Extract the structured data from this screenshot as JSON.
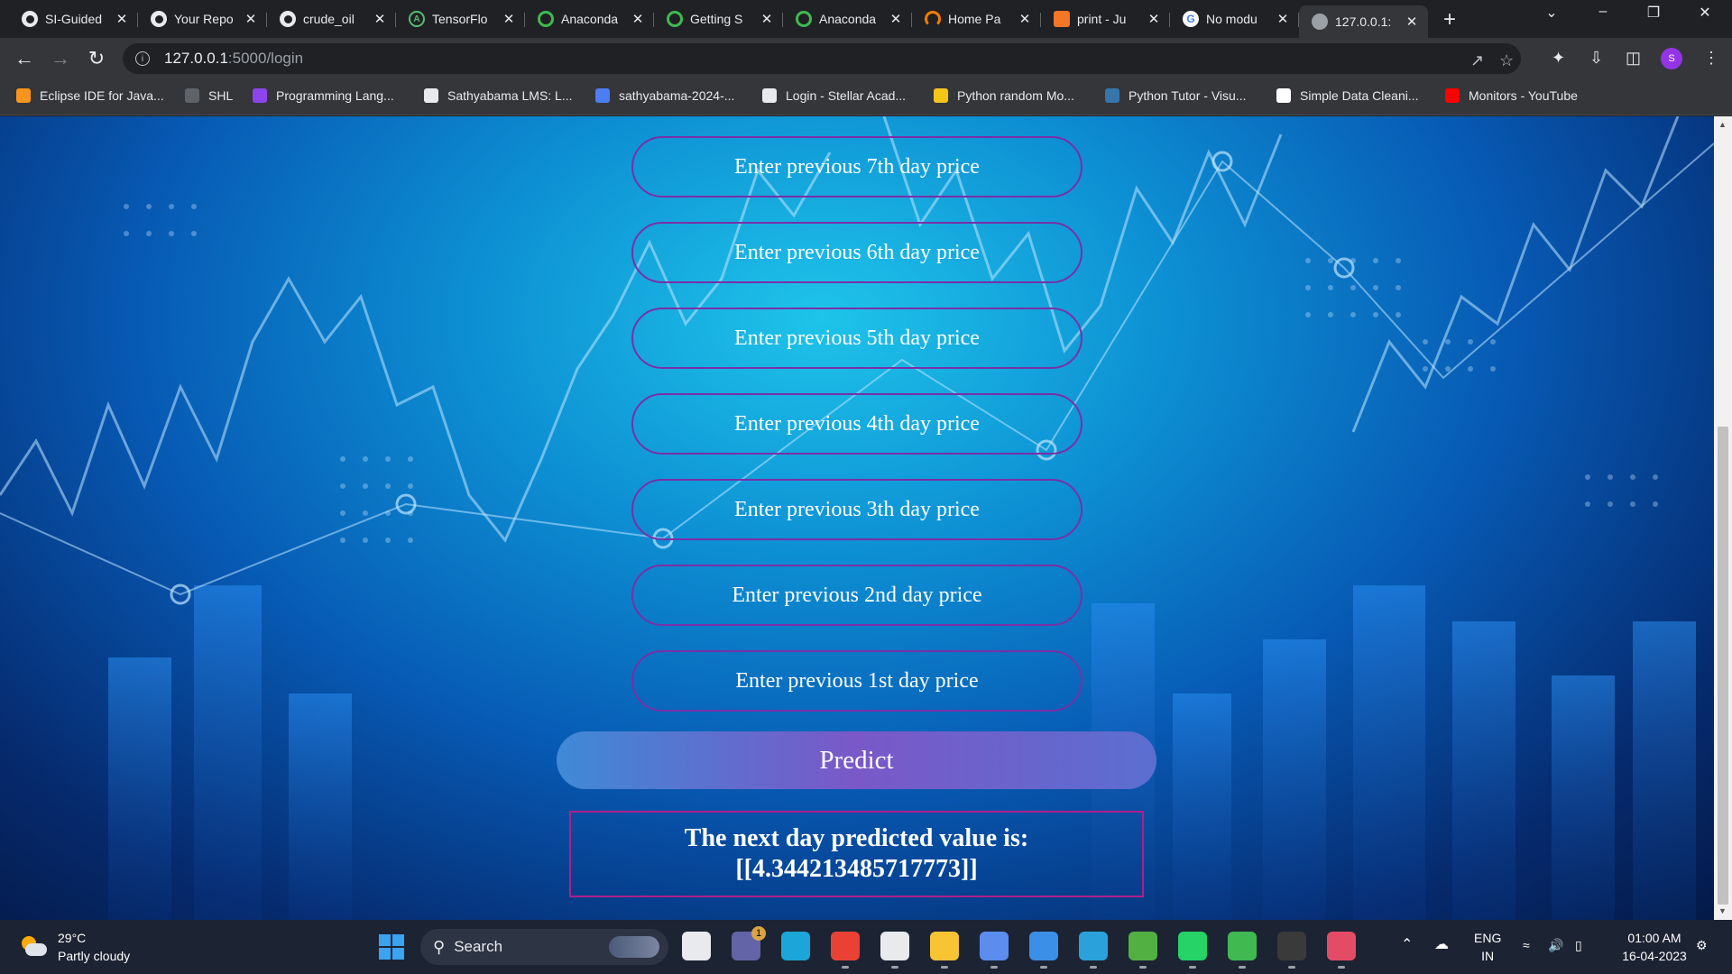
{
  "browser": {
    "tabs": [
      {
        "title": "SI-Guided",
        "favicon": "github-icon",
        "active": false
      },
      {
        "title": "Your Repo",
        "favicon": "github-icon",
        "active": false
      },
      {
        "title": "crude_oil",
        "favicon": "github-icon",
        "active": false
      },
      {
        "title": "TensorFlo",
        "favicon": "tensorflow-icon",
        "active": false
      },
      {
        "title": "Anaconda",
        "favicon": "anaconda-icon",
        "active": false
      },
      {
        "title": "Getting S",
        "favicon": "anaconda-icon",
        "active": false
      },
      {
        "title": "Anaconda",
        "favicon": "anaconda-icon",
        "active": false
      },
      {
        "title": "Home Pa",
        "favicon": "jupyter-home-icon",
        "active": false
      },
      {
        "title": "print - Ju",
        "favicon": "jupyter-notebook-icon",
        "active": false
      },
      {
        "title": "No modu",
        "favicon": "google-icon",
        "active": false
      },
      {
        "title": "127.0.0.1:",
        "favicon": "globe-icon",
        "active": true
      }
    ],
    "new_tab_glyph": "+",
    "address": {
      "host": "127.0.0.1",
      "path": ":5000/login"
    },
    "profile_initial": "S",
    "bookmarks": [
      {
        "label": "Eclipse IDE for Java...",
        "color": "#f7941e"
      },
      {
        "label": "SHL",
        "color": "#5f6368"
      },
      {
        "label": "Programming Lang...",
        "color": "#8e44ec"
      },
      {
        "label": "Sathyabama LMS: L...",
        "color": "#e8eaed"
      },
      {
        "label": "sathyabama-2024-...",
        "color": "#4c7ef3"
      },
      {
        "label": "Login - Stellar Acad...",
        "color": "#e8eaed"
      },
      {
        "label": "Python random Mo...",
        "color": "#f5c518"
      },
      {
        "label": "Python Tutor - Visu...",
        "color": "#3776ab"
      },
      {
        "label": "Simple Data Cleani...",
        "color": "#ffffff"
      },
      {
        "label": "Monitors - YouTube",
        "color": "#ff0000"
      }
    ]
  },
  "form": {
    "inputs": [
      {
        "placeholder": "Enter previous 7th day price",
        "value": ""
      },
      {
        "placeholder": "Enter previous 6th day price",
        "value": ""
      },
      {
        "placeholder": "Enter previous 5th day price",
        "value": ""
      },
      {
        "placeholder": "Enter previous 4th day price",
        "value": ""
      },
      {
        "placeholder": "Enter previous 3th day price",
        "value": ""
      },
      {
        "placeholder": "Enter previous 2nd day price",
        "value": ""
      },
      {
        "placeholder": "Enter previous 1st day price",
        "value": ""
      }
    ],
    "predict_label": "Predict",
    "result_line1": "The next day predicted value is:",
    "result_line2": "[[4.344213485717773]]"
  },
  "taskbar": {
    "weather_temp": "29°C",
    "weather_desc": "Partly cloudy",
    "search_label": "Search",
    "teams_badge": "1",
    "apps": [
      {
        "name": "task-view-icon",
        "color": "#e8eaed"
      },
      {
        "name": "teams-icon",
        "color": "#6264a7"
      },
      {
        "name": "edge-icon",
        "color": "#1ba5d8"
      },
      {
        "name": "chrome-icon",
        "color": "#e94235"
      },
      {
        "name": "store-icon",
        "color": "#e8eaed"
      },
      {
        "name": "file-explorer-icon",
        "color": "#f8c434"
      },
      {
        "name": "copilot-icon",
        "color": "#5b8def"
      },
      {
        "name": "mail-icon",
        "color": "#3b8fe6"
      },
      {
        "name": "telegram-icon",
        "color": "#2aa1da"
      },
      {
        "name": "stack-app-icon",
        "color": "#52b043"
      },
      {
        "name": "whatsapp-icon",
        "color": "#25d366"
      },
      {
        "name": "anaconda-navigator-icon",
        "color": "#3fb950"
      },
      {
        "name": "terminal-icon",
        "color": "#3a3a3a"
      },
      {
        "name": "snipping-tool-icon",
        "color": "#e44c65"
      }
    ],
    "language_line1": "ENG",
    "language_line2": "IN",
    "time": "01:00 AM",
    "date": "16-04-2023"
  }
}
